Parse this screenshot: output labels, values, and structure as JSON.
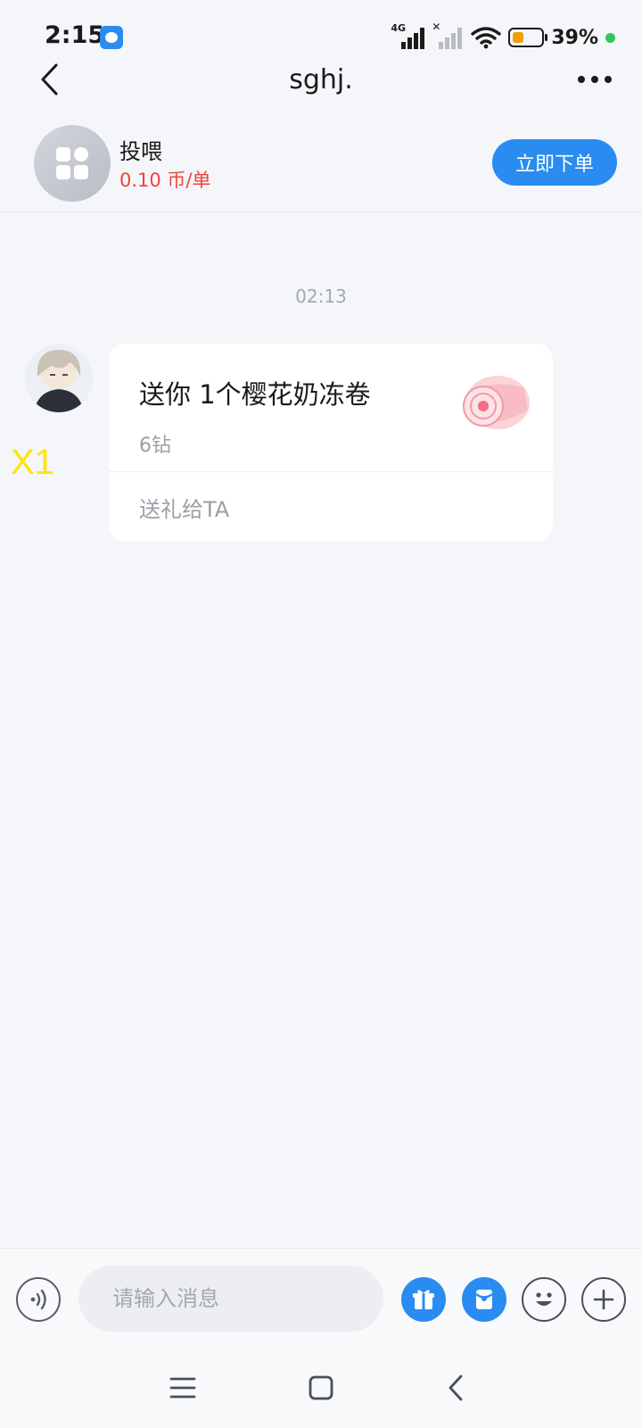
{
  "status_bar": {
    "time": "2:15",
    "network_type": "4G",
    "battery_percent": "39%",
    "battery_level": 0.39,
    "battery_color": "#f0a000"
  },
  "header": {
    "back_icon": "chevron-left-icon",
    "title": "sghj.",
    "more_icon": "more-dots-icon"
  },
  "service": {
    "icon": "apps-grid-icon",
    "name": "投喂",
    "price": "0.10 币/单",
    "order_button": "立即下单",
    "accent_color": "#2a8cf0",
    "price_color": "#f0443a"
  },
  "chat": {
    "timestamp": "02:13",
    "overlay_label": "X1",
    "gift_message": {
      "title": "送你 1个樱花奶冻卷",
      "price": "6钻",
      "action": "送礼给TA",
      "image": "cake-roll-icon"
    }
  },
  "input_bar": {
    "placeholder": "请输入消息",
    "voice_icon": "voice-icon",
    "gift_icon": "gift-icon",
    "redpacket_icon": "red-packet-icon",
    "emoji_icon": "emoji-icon",
    "plus_icon": "plus-icon"
  },
  "nav_bar": {
    "menu_icon": "menu-icon",
    "home_icon": "home-square-icon",
    "back_icon": "back-triangle-icon"
  }
}
